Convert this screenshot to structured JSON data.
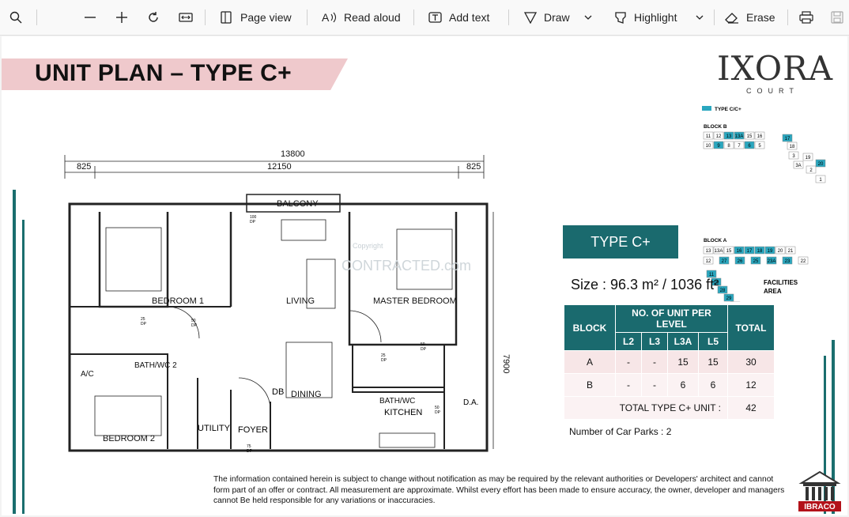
{
  "toolbar": {
    "page_view": "Page view",
    "read_aloud": "Read aloud",
    "add_text": "Add text",
    "draw": "Draw",
    "highlight": "Highlight",
    "erase": "Erase"
  },
  "doc": {
    "title": "UNIT PLAN – TYPE C+",
    "logo": "IXORA",
    "logo_sub": "COURT",
    "type_label": "TYPE C+",
    "size_text": "Size : 96.3 m² / 1036 ft²",
    "car_parks": "Number of Car Parks : 2",
    "disclaimer": "The information contained herein is subject to change without notification as may be required by the relevant authorities or Developers' architect and cannot form part of an offer or contract. All measurement are approximate. Whilst every effort has been made to ensure accuracy, the owner, developer and managers cannot Be held responsible for any variations or inaccuracies.",
    "developer": "IBRACO",
    "watermark": "Copyright",
    "watermark2": "CONTRACTED.com"
  },
  "keyplan": {
    "legend": "TYPE C/C+",
    "block_b": "BLOCK B",
    "block_a": "BLOCK A",
    "facilities": "FACILITIES",
    "area": "AREA",
    "b_row1": [
      "11",
      "12",
      "13",
      "13A",
      "15",
      "16"
    ],
    "b_row2": [
      "10",
      "9",
      "8",
      "7",
      "6",
      "5"
    ],
    "b_arc": [
      "17",
      "18",
      "3",
      "3A",
      "19",
      "2",
      "20",
      "1"
    ],
    "a_row1": [
      "13",
      "13A",
      "15",
      "16",
      "17",
      "18",
      "19",
      "20",
      "21"
    ],
    "a_row2": [
      "12",
      "27",
      "26",
      "25",
      "23A",
      "23",
      "22"
    ],
    "a_left": [
      "11",
      "10",
      "28",
      "29",
      "30",
      "31"
    ],
    "a_bottom": [
      "32",
      "33",
      "33A",
      "35",
      "5",
      "3A",
      "3",
      "2",
      "1"
    ]
  },
  "plan": {
    "dim_total": "13800",
    "dim_mid": "12150",
    "dim_left": "825",
    "dim_right": "825",
    "dim_height": "7900",
    "balcony": "BALCONY",
    "bedroom1": "BEDROOM 1",
    "living": "LIVING",
    "master": "MASTER BEDROOM",
    "bathwc2": "BATH/WC 2",
    "ac": "A/C",
    "dining": "DINING",
    "bathwc": "BATH/WC",
    "bedroom2": "BEDROOM 2",
    "utility": "UTILITY",
    "foyer": "FOYER",
    "db": "DB",
    "kitchen": "KITCHEN",
    "da": "D.A.",
    "dp100": "100 DP",
    "dp50a": "50 DP",
    "dp25a": "25 DP",
    "dp50b": "50 DP",
    "dp25b": "25 DP",
    "dp50c": "50 DP",
    "dp75": "75 DP"
  },
  "table": {
    "h_block": "BLOCK",
    "h_units": "NO. OF UNIT PER LEVEL",
    "h_total": "TOTAL",
    "levels": [
      "L2",
      "L3",
      "L3A",
      "L5"
    ],
    "rows": [
      {
        "block": "A",
        "v": [
          "-",
          "-",
          "15",
          "15"
        ],
        "total": "30"
      },
      {
        "block": "B",
        "v": [
          "-",
          "-",
          "6",
          "6"
        ],
        "total": "12"
      }
    ],
    "total_label": "TOTAL TYPE C+ UNIT :",
    "total_value": "42"
  },
  "colors": {
    "teal": "#1a6a6e",
    "pink": "#efc9cc",
    "keyplan_teal": "#2aa7bf"
  }
}
